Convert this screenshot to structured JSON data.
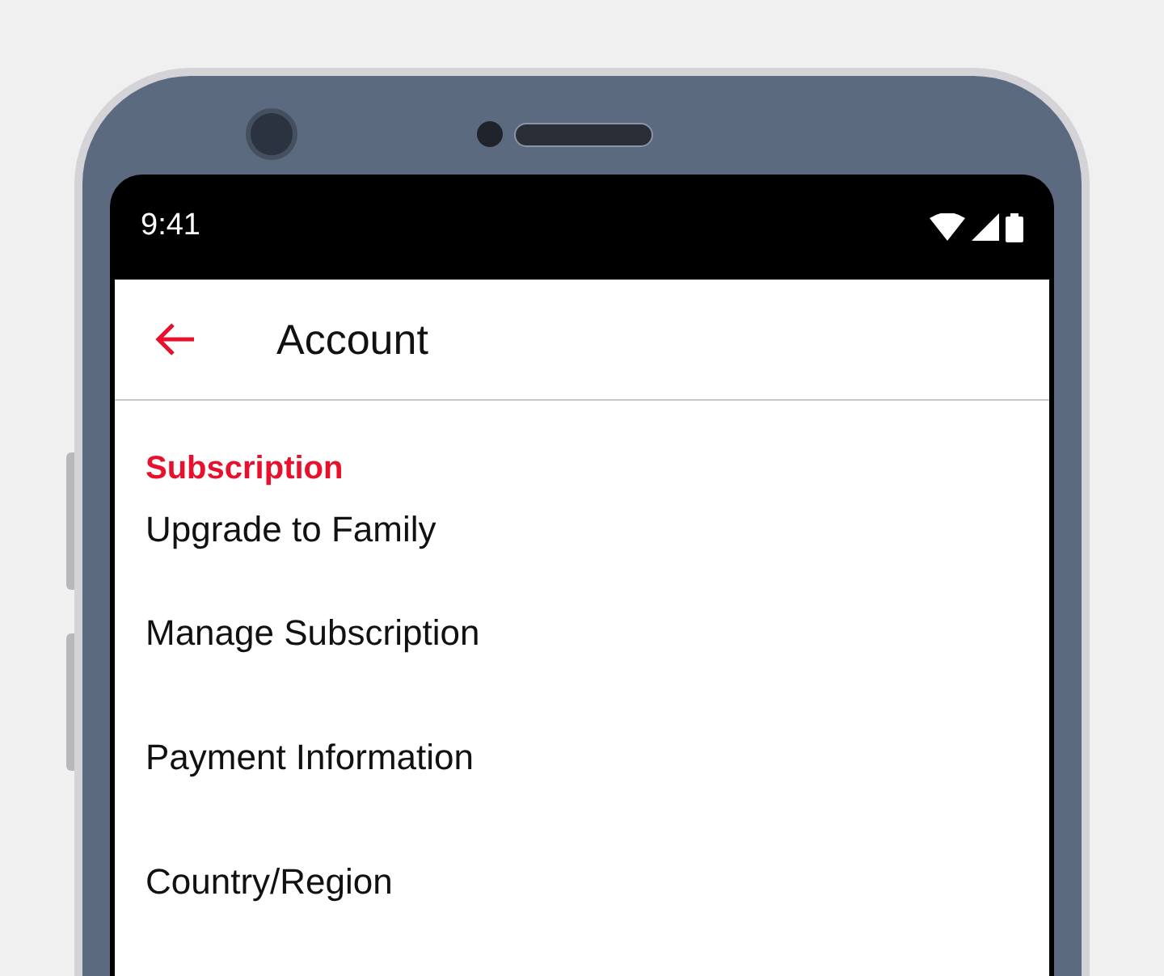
{
  "status_bar": {
    "time": "9:41"
  },
  "app_bar": {
    "title": "Account"
  },
  "sections": [
    {
      "header": "Subscription",
      "items": [
        "Upgrade to Family",
        "Manage Subscription",
        "Payment Information",
        "Country/Region"
      ]
    }
  ]
}
